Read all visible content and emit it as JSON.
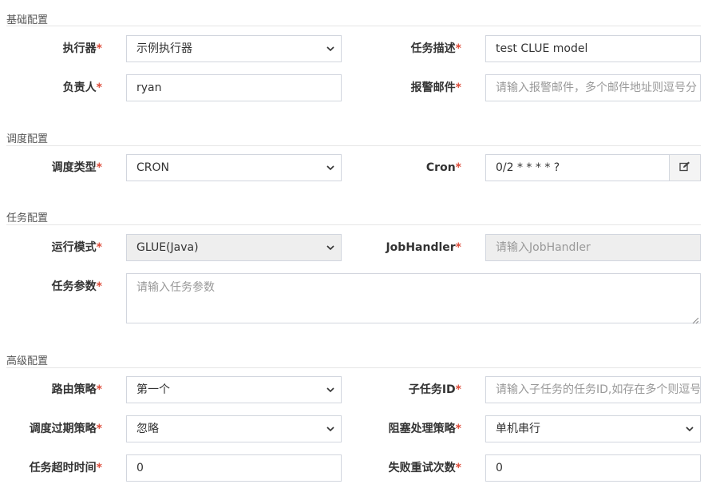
{
  "sections": {
    "basic": "基础配置",
    "schedule": "调度配置",
    "task": "任务配置",
    "advanced": "高级配置"
  },
  "fields": {
    "executor": {
      "label": "执行器",
      "value": "示例执行器"
    },
    "job_desc": {
      "label": "任务描述",
      "value": "test CLUE model"
    },
    "author": {
      "label": "负责人",
      "value": "ryan"
    },
    "alarm_email": {
      "label": "报警邮件",
      "placeholder": "请输入报警邮件，多个邮件地址则逗号分"
    },
    "schedule_type": {
      "label": "调度类型",
      "value": "CRON"
    },
    "cron": {
      "label": "Cron",
      "value": "0/2 * * * * ?",
      "edit_icon": "edit-icon"
    },
    "run_mode": {
      "label": "运行模式",
      "value": "GLUE(Java)"
    },
    "job_handler": {
      "label": "JobHandler",
      "placeholder": "请输入JobHandler"
    },
    "job_param": {
      "label": "任务参数",
      "placeholder": "请输入任务参数"
    },
    "route_strategy": {
      "label": "路由策略",
      "value": "第一个"
    },
    "child_job_id": {
      "label": "子任务ID",
      "placeholder": "请输入子任务的任务ID,如存在多个则逗号"
    },
    "misfire_strategy": {
      "label": "调度过期策略",
      "value": "忽略"
    },
    "block_strategy": {
      "label": "阻塞处理策略",
      "value": "单机串行"
    },
    "timeout": {
      "label": "任务超时时间",
      "value": "0"
    },
    "fail_retry": {
      "label": "失败重试次数",
      "value": "0"
    }
  },
  "required_mark": "*",
  "colors": {
    "required": "#dd4b39",
    "border": "#d2d6de",
    "disabled_bg": "#eeeeee",
    "addon_bg": "#f4f4f4"
  }
}
